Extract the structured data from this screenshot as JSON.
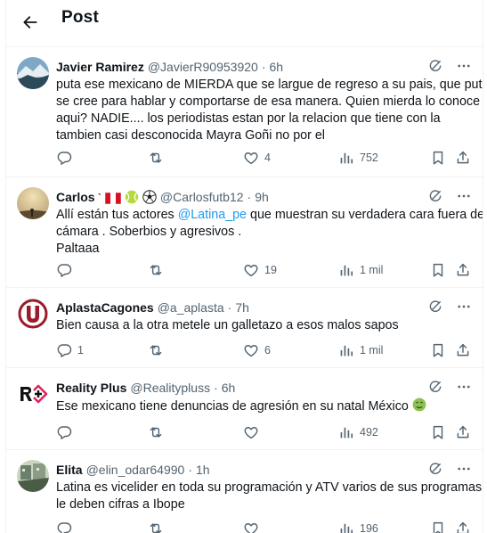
{
  "header": {
    "title": "Post",
    "back_icon": "arrow-left-icon"
  },
  "colors": {
    "text": "#0f1419",
    "muted": "#536471",
    "link": "#1d9bf0",
    "border": "#eff3f4"
  },
  "replies": [
    {
      "name": "Javier Ramirez",
      "handle": "@JavierR90953920",
      "time": "6h",
      "lines": [
        "puta ese mexicano de MIERDA que se largue de regreso a su pais, que puta",
        "se cree para hablar y comportarse de esa manera. Quien mierda lo conoce",
        "aqui? NADIE.... los periodistas estan por la relacion que tiene con la",
        "tambien casi desconocida Mayra Goñi no por el"
      ],
      "replies_count": "",
      "reposts_count": "",
      "likes_count": "4",
      "views_count": "752"
    },
    {
      "name": "Carlos",
      "handle": "@Carlosfutb12",
      "time": "9h",
      "line1_before": "Allí están tus actores ",
      "mention": "@Latina_pe",
      "line1_after": " que muestran su verdadera cara fuera de",
      "lines": [
        "cámara . Soberbios y agresivos .",
        "Paltaaa"
      ],
      "replies_count": "",
      "reposts_count": "",
      "likes_count": "19",
      "views_count": "1 mil"
    },
    {
      "name": "AplastaCagones",
      "handle": "@a_aplasta",
      "time": "7h",
      "lines": [
        "Bien causa a la otra metele un galletazo a esos malos sapos"
      ],
      "replies_count": "1",
      "reposts_count": "",
      "likes_count": "6",
      "views_count": "1 mil"
    },
    {
      "name": "Reality Plus",
      "handle": "@Realitypluss",
      "time": "6h",
      "lines": [
        "Ese mexicano tiene denuncias de agresión en su natal México"
      ],
      "replies_count": "",
      "reposts_count": "",
      "likes_count": "",
      "views_count": "492"
    },
    {
      "name": "Elita",
      "handle": "@elin_odar64990",
      "time": "1h",
      "lines": [
        "Latina es vicelider en toda su programación y ATV varios de sus programas",
        "le deben cifras a Ibope"
      ],
      "replies_count": "",
      "reposts_count": "",
      "likes_count": "",
      "views_count": "196"
    }
  ]
}
